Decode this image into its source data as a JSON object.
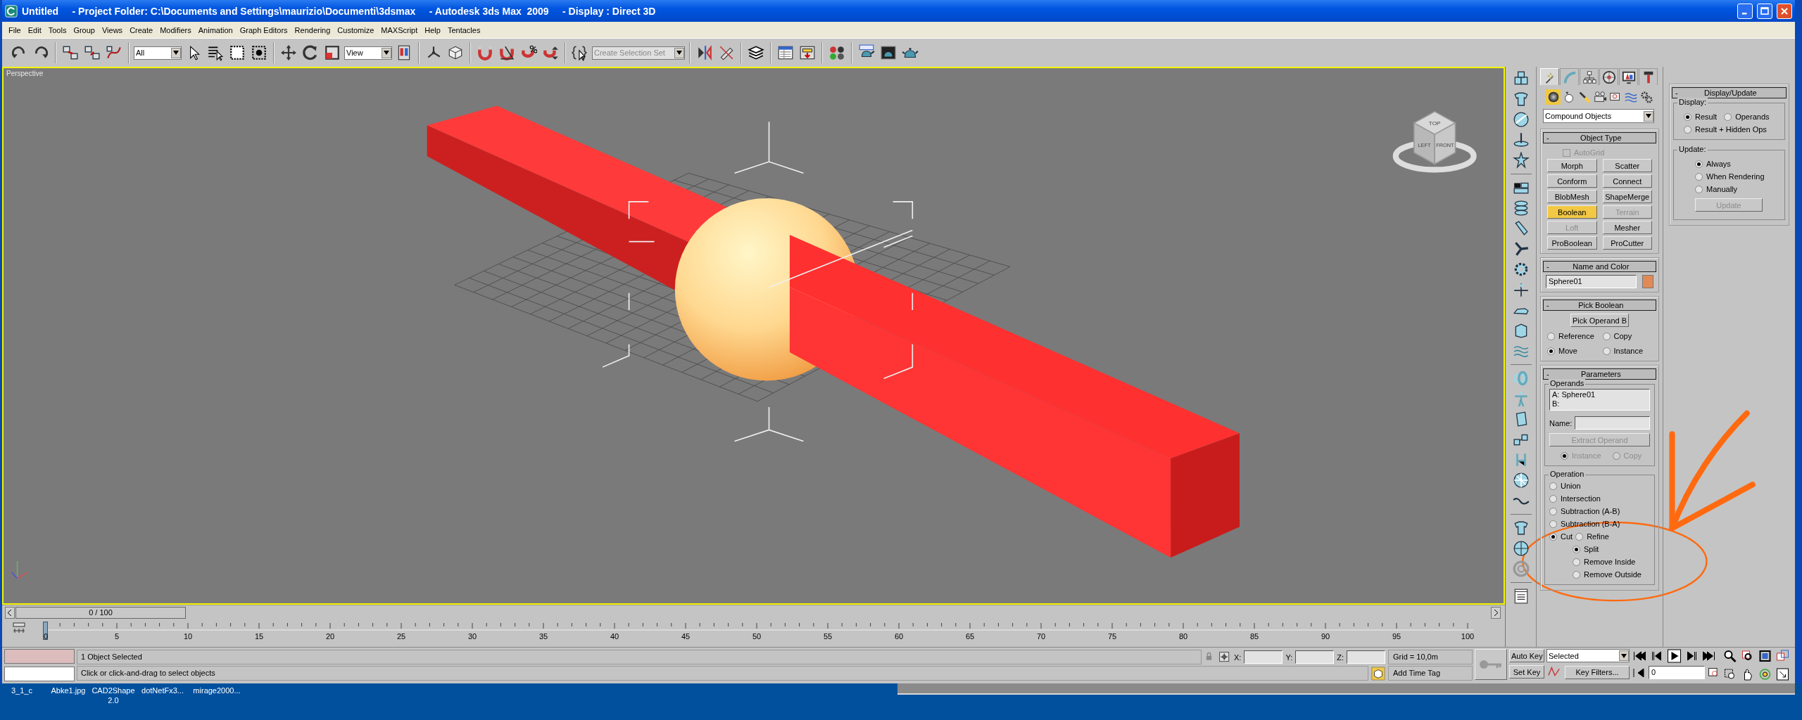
{
  "window": {
    "title": "Untitled     - Project Folder: C:\\Documents and Settings\\maurizio\\Documenti\\3dsmax     - Autodesk 3ds Max  2009     - Display : Direct 3D"
  },
  "menu_bar": [
    "File",
    "Edit",
    "Tools",
    "Group",
    "Views",
    "Create",
    "Modifiers",
    "Animation",
    "Graph Editors",
    "Rendering",
    "Customize",
    "MAXScript",
    "Help",
    "Tentacles"
  ],
  "toolbar": {
    "selection_filter": "All",
    "reference_coordinate_system": "View",
    "named_selection_set": {
      "placeholder": "Create Selection Set"
    }
  },
  "viewport": {
    "label": "Perspective",
    "viewcube_labels": [
      "TOP",
      "LEFT",
      "FRONT"
    ]
  },
  "command_panel": {
    "tabs": [
      {
        "selected": true
      },
      {
        "selected": false
      },
      {
        "selected": false
      },
      {
        "selected": false
      },
      {
        "selected": false
      },
      {
        "selected": false
      }
    ],
    "categories": [
      {
        "selected": true
      },
      {
        "selected": false
      },
      {
        "selected": false
      },
      {
        "selected": false
      },
      {
        "selected": false
      },
      {
        "selected": false
      },
      {
        "selected": false
      }
    ],
    "dropdown": "Compound Objects",
    "rollouts": [
      {
        "kind": "object_type",
        "toggle": "-",
        "title": "Object Type",
        "autogrid": {
          "label": "AutoGrid",
          "checked": false,
          "disabled": true
        },
        "buttons": [
          {
            "label": "Morph",
            "selected": false,
            "disabled": false
          },
          {
            "label": "Scatter",
            "selected": false,
            "disabled": false
          },
          {
            "label": "Conform",
            "selected": false,
            "disabled": false
          },
          {
            "label": "Connect",
            "selected": false,
            "disabled": false
          },
          {
            "label": "BlobMesh",
            "selected": false,
            "disabled": false
          },
          {
            "label": "ShapeMerge",
            "selected": false,
            "disabled": false
          },
          {
            "label": "Boolean",
            "selected": true,
            "disabled": false
          },
          {
            "label": "Terrain",
            "selected": false,
            "disabled": true
          },
          {
            "label": "Loft",
            "selected": false,
            "disabled": true
          },
          {
            "label": "Mesher",
            "selected": false,
            "disabled": false
          },
          {
            "label": "ProBoolean",
            "selected": false,
            "disabled": false
          },
          {
            "label": "ProCutter",
            "selected": false,
            "disabled": false
          }
        ]
      },
      {
        "kind": "name_color",
        "toggle": "-",
        "title": "Name and Color",
        "name": "Sphere01",
        "color": "#e08b57"
      },
      {
        "kind": "pick",
        "toggle": "-",
        "title": "Pick Boolean",
        "button": "Pick Operand B",
        "options": [
          {
            "label": "Reference",
            "selected": false
          },
          {
            "label": "Copy",
            "selected": false
          },
          {
            "label": "Move",
            "selected": true
          },
          {
            "label": "Instance",
            "selected": false
          }
        ]
      },
      {
        "kind": "parameters",
        "toggle": "-",
        "title": "Parameters",
        "operands": {
          "title": "Operands",
          "items": [
            "A: Sphere01",
            "B:"
          ],
          "name_label": "Name:",
          "extract_button": {
            "label": "Extract Operand",
            "disabled": true
          },
          "copy_options": [
            {
              "label": "Instance",
              "selected": true,
              "disabled": true
            },
            {
              "label": "Copy",
              "selected": false,
              "disabled": true
            }
          ]
        },
        "operation": {
          "title": "Operation",
          "options": [
            {
              "label": "Union",
              "selected": false
            },
            {
              "label": "Intersection",
              "selected": false
            },
            {
              "label": "Subtraction (A-B)",
              "selected": false
            },
            {
              "label": "Subtraction (B-A)",
              "selected": false
            },
            {
              "label": "Cut",
              "selected": true,
              "sub_options": [
                {
                  "label": "Refine",
                  "selected": false
                },
                {
                  "label": "Split",
                  "selected": true
                },
                {
                  "label": "Remove Inside",
                  "selected": false
                },
                {
                  "label": "Remove Outside",
                  "selected": false
                }
              ]
            }
          ]
        }
      }
    ]
  },
  "display_update": {
    "toggle": "-",
    "title": "Display/Update",
    "display": {
      "title": "Display:",
      "options": [
        {
          "label": "Result",
          "selected": true
        },
        {
          "label": "Operands",
          "selected": false
        },
        {
          "label": "Result + Hidden Ops",
          "selected": false
        }
      ]
    },
    "update": {
      "title": "Update:",
      "options": [
        {
          "label": "Always",
          "selected": true
        },
        {
          "label": "When Rendering",
          "selected": false
        },
        {
          "label": "Manually",
          "selected": false
        }
      ],
      "button": {
        "label": "Update",
        "disabled": true
      }
    }
  },
  "time_slider": {
    "label": "0 / 100",
    "level": 0
  },
  "track_bar": {
    "labels": [
      "0",
      "5",
      "10",
      "15",
      "20",
      "25",
      "30",
      "35",
      "40",
      "45",
      "50",
      "55",
      "60",
      "65",
      "70",
      "75",
      "80",
      "85",
      "90",
      "95",
      "100"
    ]
  },
  "status_bar": {
    "selection_info": "1 Object Selected",
    "prompt": "Click or click-and-drag to select objects",
    "coordinates": [
      "X:",
      "Y:",
      "Z:"
    ],
    "grid": "Grid = 10,0m",
    "time_tag": "Add Time Tag"
  },
  "animation_controls": {
    "auto_key": "Auto Key",
    "set_key": "Set Key",
    "key_mode": "Selected",
    "key_filters": "Key Filters...",
    "frame": "0"
  },
  "desktop": {
    "icons": [
      "3_1_c",
      "Abke1.jpg",
      "CAD2Shape 2.0",
      "dotNetFx3...",
      "mirage2000..."
    ]
  }
}
